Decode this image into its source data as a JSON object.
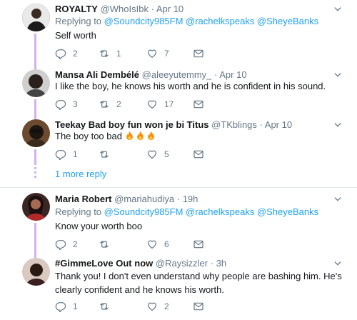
{
  "tweets": [
    {
      "name": "ROYALTY",
      "handle": "@WhoIsIbk",
      "time": "Apr 10",
      "replying_prefix": "Replying to",
      "replying_to": "@Soundcity985FM @rachelkspeaks @SheyeBanks",
      "text": "Self worth",
      "replies": "2",
      "retweets": "1",
      "likes": "7"
    },
    {
      "name": "Mansa Ali Dembélé",
      "handle": "@aleeyutemmy_",
      "time": "Apr 10",
      "text": "I like the boy, he knows his worth and he is confident in his sound.",
      "replies": "3",
      "retweets": "2",
      "likes": "17"
    },
    {
      "name": "Teekay Bad boy fun won je bi Titus",
      "handle": "@TKblings",
      "time": "Apr 10",
      "text": "The boy too bad",
      "replies": "1",
      "retweets": "",
      "likes": "5"
    },
    {
      "name": "Maria Robert",
      "handle": "@mariahudiya",
      "time": "19h",
      "replying_prefix": "Replying to",
      "replying_to": "@Soundcity985FM @rachelkspeaks @SheyeBanks",
      "text": "Know your worth boo",
      "replies": "2",
      "retweets": "",
      "likes": "6"
    },
    {
      "name": "#GimmeLove Out now",
      "handle": "@Raysizzler",
      "time": "3h",
      "text": "Thank you! I don't even understand why people are bashing him. He's clearly confident and he knows his worth.",
      "replies": "1",
      "retweets": "",
      "likes": "2"
    }
  ],
  "more_replies": "1 more reply",
  "separator": "·",
  "colors": {
    "link": "#1da1f2",
    "thread": "#cfb2f0",
    "muted": "#657786"
  },
  "icons": [
    "reply-icon",
    "retweet-icon",
    "like-icon",
    "message-icon",
    "chevron-down-icon",
    "fire-emoji"
  ]
}
